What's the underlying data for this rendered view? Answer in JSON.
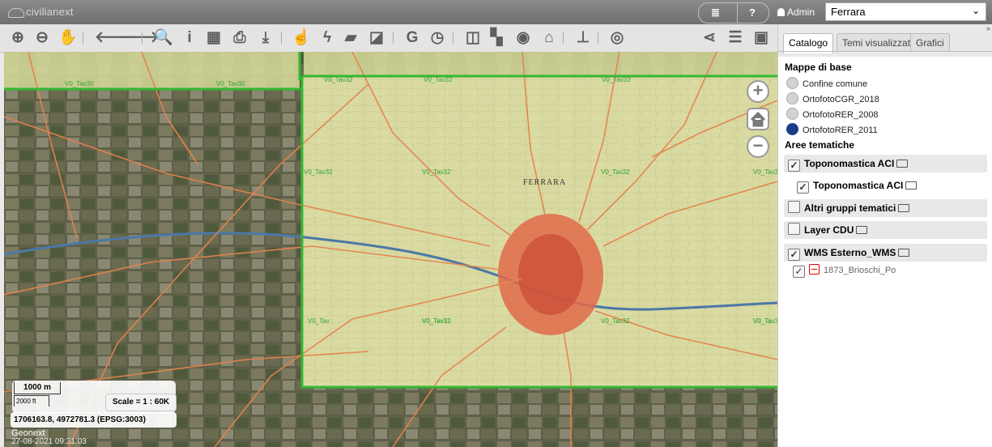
{
  "topbar": {
    "brand": "civilianext",
    "help_label": "?",
    "user": "Admin",
    "comune_select": "Ferrara",
    "colors": {
      "bar": "#7a7a7a"
    }
  },
  "toolbar": {
    "tools": [
      {
        "name": "zoom-in-icon",
        "glyph": "⊕"
      },
      {
        "name": "zoom-out-icon",
        "glyph": "⊖"
      },
      {
        "name": "pan-hand-icon",
        "glyph": "✋"
      },
      {
        "name": "back-arrow-icon",
        "glyph": "🡐"
      },
      {
        "name": "forward-arrow-icon",
        "glyph": "🡒"
      },
      {
        "name": "search-icon",
        "glyph": "🔍"
      },
      {
        "name": "info-icon",
        "glyph": "i"
      },
      {
        "name": "table-icon",
        "glyph": "▦"
      },
      {
        "name": "print-icon",
        "glyph": "⎙"
      },
      {
        "name": "download-icon",
        "glyph": "⤓"
      },
      {
        "name": "select-pointer-icon",
        "glyph": "☝"
      },
      {
        "name": "lightning-icon",
        "glyph": "ϟ"
      },
      {
        "name": "eraser-icon",
        "glyph": "▰"
      },
      {
        "name": "corner-icon",
        "glyph": "◪"
      },
      {
        "name": "google-icon",
        "glyph": "G"
      },
      {
        "name": "clock-icon",
        "glyph": "◷"
      },
      {
        "name": "columns-icon",
        "glyph": "◫"
      },
      {
        "name": "map-icon",
        "glyph": "▚"
      },
      {
        "name": "globe-icon",
        "glyph": "◉"
      },
      {
        "name": "institution-icon",
        "glyph": "⌂"
      },
      {
        "name": "pin-icon",
        "glyph": "⊥"
      },
      {
        "name": "eye-icon",
        "glyph": "◎"
      }
    ],
    "right_tools": [
      {
        "name": "share-icon",
        "glyph": "⋖"
      },
      {
        "name": "list-icon",
        "glyph": "☰"
      },
      {
        "name": "fullextent-icon",
        "glyph": "▣"
      }
    ]
  },
  "map": {
    "grid_labels": [
      "V0_Tav30",
      "V0_Tav30",
      "V0_Tav32",
      "V0_Tav32",
      "V0_Tav33",
      "V0_Tav32",
      "V0_Tav32",
      "V0_Tav32",
      "V0_Tav32",
      "V0_Tav",
      "V0_Tav32",
      "V0_Tav32",
      "V0_Tav32",
      "V0_Tav32",
      "V0_Ta"
    ],
    "city_label": "FERRARA",
    "scale_m": "1000 m",
    "scale_ft": "2000 ft",
    "scale_text": "Scale = 1 : 60K",
    "coords": "1706163.8, 4972781.3 (EPSG:3003)",
    "attribution": "Geonext",
    "timestamp": "27-08-2021 09:31:03"
  },
  "panel": {
    "tabs": [
      "Catalogo",
      "Temi visualizzati",
      "Grafici"
    ],
    "base_maps_title": "Mappe di base",
    "base_maps": [
      {
        "label": "Confine comune",
        "selected": false
      },
      {
        "label": "OrtofotoCGR_2018",
        "selected": false
      },
      {
        "label": "OrtofotoRER_2008",
        "selected": false
      },
      {
        "label": "OrtofotoRER_2011",
        "selected": true
      }
    ],
    "thematic_title": "Aree tematiche",
    "groups": {
      "g1": "Toponomastica ACI",
      "g1_sub": "Toponomastica ACI",
      "g2": "Altri gruppi tematici",
      "g3": "Layer CDU",
      "g4": "WMS Esterno_WMS",
      "g4_layer": "1873_Brioschi_Po"
    }
  }
}
